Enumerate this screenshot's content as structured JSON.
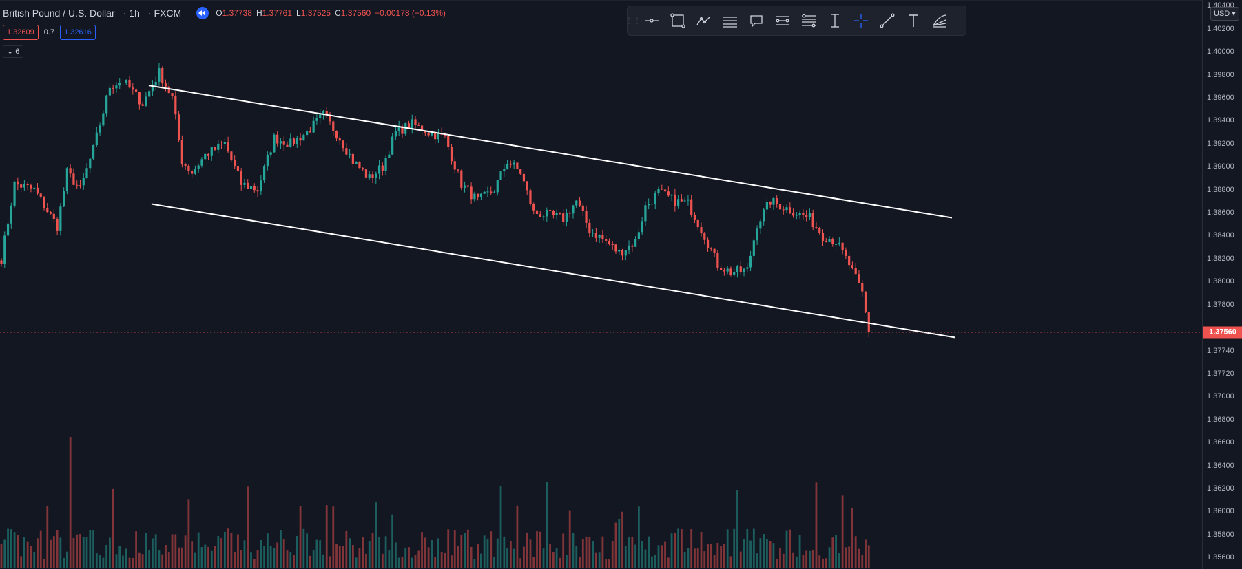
{
  "symbol": {
    "name": "British Pound / U.S. Dollar",
    "interval": "1h",
    "exchange": "FXCM",
    "sep": "·"
  },
  "ohlc": {
    "o_label": "O",
    "o": "1.37738",
    "h_label": "H",
    "h": "1.37761",
    "l_label": "L",
    "l": "1.37525",
    "c_label": "C",
    "c": "1.37560",
    "change": "−0.00178 (−0.13%)"
  },
  "quote": {
    "bid": "1.32609",
    "spread": "0.7",
    "ask": "1.32616"
  },
  "indicators_count": "6",
  "currency": "USD",
  "colors": {
    "up": "#26a69a",
    "down": "#ef5350",
    "bg": "#131722",
    "accent": "#2962ff",
    "trendline": "#ffffff"
  },
  "toolbar_icons": [
    "horizontal-line-icon",
    "rectangle-icon",
    "path-icon",
    "parallel-channel-icon",
    "callout-icon",
    "price-range-icon",
    "date-range-icon",
    "date-price-range-icon",
    "crosshair-icon",
    "trend-line-icon",
    "text-icon",
    "fib-fan-icon"
  ],
  "price_axis": {
    "ticks": [
      "1.40400",
      "1.40200",
      "1.40000",
      "1.39800",
      "1.39600",
      "1.39400",
      "1.39200",
      "1.39000",
      "1.38800",
      "1.38600",
      "1.38400",
      "1.38200",
      "1.38000",
      "1.37800",
      "1.37740",
      "1.37720",
      "1.37000",
      "1.36800",
      "1.36600",
      "1.36400",
      "1.36200",
      "1.36000",
      "1.35800",
      "1.35600"
    ],
    "current_price": "1.37560"
  },
  "chart_data": {
    "type": "candlestick",
    "y_range": [
      1.355,
      1.4045
    ],
    "y_ticks": [
      1.404,
      1.402,
      1.4,
      1.398,
      1.396,
      1.394,
      1.392,
      1.39,
      1.388,
      1.386,
      1.384,
      1.382,
      1.38,
      1.378,
      1.374,
      1.372,
      1.37,
      1.368,
      1.366,
      1.364,
      1.362,
      1.36,
      1.358,
      1.356
    ],
    "candle_count": 265,
    "anchors": [
      [
        0,
        1.382
      ],
      [
        4,
        1.3885
      ],
      [
        10,
        1.388
      ],
      [
        17,
        1.3848
      ],
      [
        20,
        1.3895
      ],
      [
        24,
        1.388
      ],
      [
        28,
        1.3915
      ],
      [
        33,
        1.397
      ],
      [
        37,
        1.3975
      ],
      [
        43,
        1.3955
      ],
      [
        48,
        1.3982
      ],
      [
        52,
        1.396
      ],
      [
        55,
        1.3905
      ],
      [
        58,
        1.3895
      ],
      [
        62,
        1.391
      ],
      [
        68,
        1.392
      ],
      [
        73,
        1.3885
      ],
      [
        78,
        1.388
      ],
      [
        83,
        1.3925
      ],
      [
        88,
        1.392
      ],
      [
        93,
        1.393
      ],
      [
        98,
        1.3945
      ],
      [
        103,
        1.3925
      ],
      [
        107,
        1.3905
      ],
      [
        112,
        1.389
      ],
      [
        116,
        1.39
      ],
      [
        120,
        1.393
      ],
      [
        125,
        1.3937
      ],
      [
        130,
        1.393
      ],
      [
        135,
        1.3925
      ],
      [
        140,
        1.3885
      ],
      [
        145,
        1.387
      ],
      [
        150,
        1.388
      ],
      [
        154,
        1.3905
      ],
      [
        158,
        1.3895
      ],
      [
        162,
        1.386
      ],
      [
        166,
        1.3858
      ],
      [
        171,
        1.3855
      ],
      [
        175,
        1.387
      ],
      [
        179,
        1.3845
      ],
      [
        184,
        1.3835
      ],
      [
        188,
        1.3825
      ],
      [
        193,
        1.3835
      ],
      [
        196,
        1.3865
      ],
      [
        200,
        1.3878
      ],
      [
        205,
        1.387
      ],
      [
        209,
        1.3868
      ],
      [
        214,
        1.384
      ],
      [
        218,
        1.3815
      ],
      [
        222,
        1.3808
      ],
      [
        227,
        1.381
      ],
      [
        230,
        1.385
      ],
      [
        234,
        1.387
      ],
      [
        238,
        1.3865
      ],
      [
        242,
        1.386
      ],
      [
        246,
        1.3855
      ],
      [
        250,
        1.384
      ],
      [
        254,
        1.3835
      ],
      [
        258,
        1.3815
      ],
      [
        262,
        1.379
      ],
      [
        264,
        1.3756
      ]
    ],
    "trendlines": [
      {
        "from": [
          0,
          1.3992
        ],
        "to": [
          272,
          1.3864
        ]
      },
      {
        "from": [
          0,
          1.3889
        ],
        "to": [
          272,
          1.376
        ]
      }
    ]
  }
}
